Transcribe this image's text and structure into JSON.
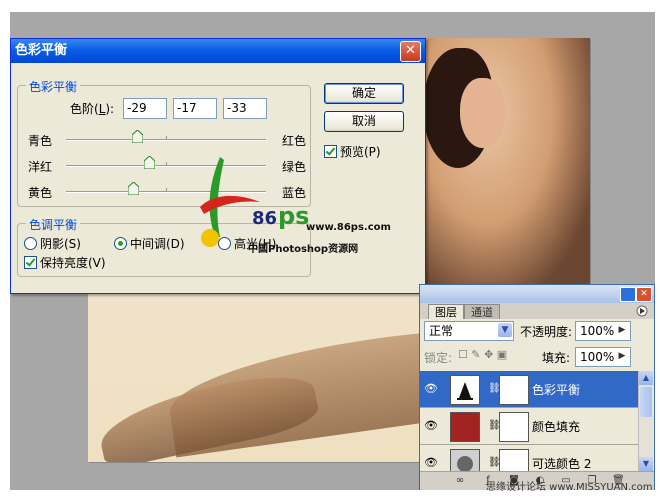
{
  "dialog": {
    "title": "色彩平衡",
    "close_glyph": "✕",
    "color_balance_group": "色彩平衡",
    "levels_label": "色阶(",
    "levels_key": "L",
    "levels_suffix": "):",
    "levels": [
      "-29",
      "-17",
      "-33"
    ],
    "slider_rows": [
      {
        "left": "青色",
        "right": "红色",
        "value": -29
      },
      {
        "left": "洋红",
        "right": "绿色",
        "value": -17
      },
      {
        "left": "黄色",
        "right": "蓝色",
        "value": -33
      }
    ],
    "tone_group": "色调平衡",
    "shadows": "阴影(S)",
    "midtones": "中间调(D)",
    "highlights": "高光(H)",
    "selected_tone": "midtones",
    "preserve_luminosity": "保持亮度(V)",
    "preserve_checked": true,
    "ok": "确定",
    "cancel": "取消",
    "preview": "预览(P)",
    "preview_checked": true
  },
  "logo": {
    "number": "86",
    "letters": "ps",
    "url": "www.86ps.com",
    "caption": "中国Photoshop资源网"
  },
  "layers_panel": {
    "tabs": [
      "图层",
      "通道"
    ],
    "blend_mode": "正常",
    "opacity_label": "不透明度:",
    "opacity_value": "100%",
    "lock_label": "锁定:",
    "fill_label": "填充:",
    "fill_value": "100%",
    "layers": [
      {
        "name": "色彩平衡",
        "selected": true,
        "thumb_color": "#ffffff"
      },
      {
        "name": "颜色填充",
        "selected": false,
        "thumb_color": "#a32323"
      },
      {
        "name": "可选颜色 2",
        "selected": false,
        "thumb_color": "#666666"
      }
    ],
    "icons": [
      "link-icon",
      "fx-icon",
      "mask-icon",
      "adjustment-icon",
      "folder-icon",
      "new-layer-icon",
      "trash-icon"
    ]
  },
  "footer": {
    "watermark": "思缘设计论坛 www.MISSYUAN.com"
  },
  "colors": {
    "title_blue": "#0a5fe6",
    "group_title": "#0046d5",
    "selected_row": "#3169c6",
    "fill_red": "#a32323"
  }
}
